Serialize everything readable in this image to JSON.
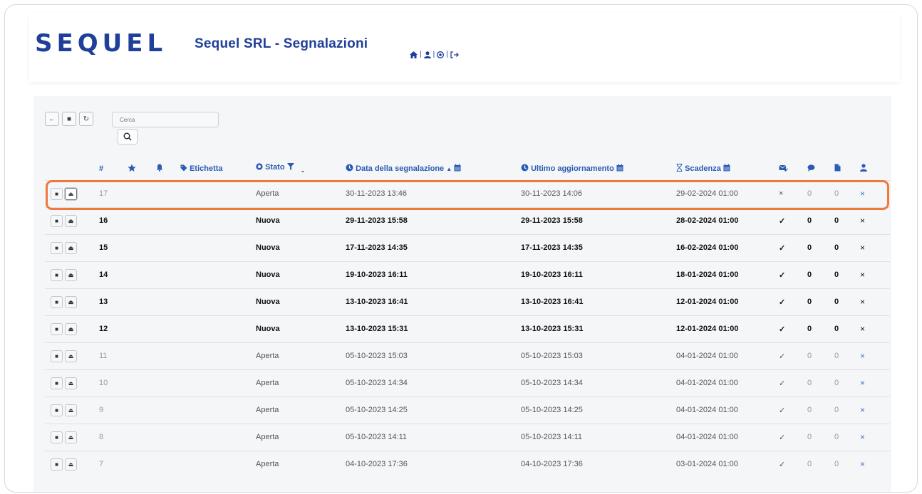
{
  "header": {
    "logo_text": "SEQUEL",
    "title": "Sequel SRL - Segnalazioni",
    "nav_icons": [
      "home-icon",
      "user-icon",
      "settings-icon",
      "logout-icon"
    ]
  },
  "toolbar": {
    "back_icon": "←",
    "stop_icon": "■",
    "refresh_icon": "↻"
  },
  "search": {
    "placeholder": "Cerca"
  },
  "table": {
    "columns": {
      "hash": "#",
      "label": "Etichetta",
      "status": "Stato",
      "date": "Data della segnalazione",
      "updated": "Ultimo aggiornamento",
      "deadline": "Scadenza"
    },
    "rows": [
      {
        "id": "17",
        "stato": "Aperta",
        "data": "30-11-2023 13:46",
        "ultimo": "30-11-2023 14:06",
        "scadenza": "29-02-2024 01:00",
        "mail": "×",
        "commenti": "0",
        "allegati": "0",
        "user": "×"
      },
      {
        "id": "16",
        "stato": "Nuova",
        "data": "29-11-2023 15:58",
        "ultimo": "29-11-2023 15:58",
        "scadenza": "28-02-2024 01:00",
        "mail": "✓",
        "commenti": "0",
        "allegati": "0",
        "user": "×"
      },
      {
        "id": "15",
        "stato": "Nuova",
        "data": "17-11-2023 14:35",
        "ultimo": "17-11-2023 14:35",
        "scadenza": "16-02-2024 01:00",
        "mail": "✓",
        "commenti": "0",
        "allegati": "0",
        "user": "×"
      },
      {
        "id": "14",
        "stato": "Nuova",
        "data": "19-10-2023 16:11",
        "ultimo": "19-10-2023 16:11",
        "scadenza": "18-01-2024 01:00",
        "mail": "✓",
        "commenti": "0",
        "allegati": "0",
        "user": "×"
      },
      {
        "id": "13",
        "stato": "Nuova",
        "data": "13-10-2023 16:41",
        "ultimo": "13-10-2023 16:41",
        "scadenza": "12-01-2024 01:00",
        "mail": "✓",
        "commenti": "0",
        "allegati": "0",
        "user": "×"
      },
      {
        "id": "12",
        "stato": "Nuova",
        "data": "13-10-2023 15:31",
        "ultimo": "13-10-2023 15:31",
        "scadenza": "12-01-2024 01:00",
        "mail": "✓",
        "commenti": "0",
        "allegati": "0",
        "user": "×"
      },
      {
        "id": "11",
        "stato": "Aperta",
        "data": "05-10-2023 15:03",
        "ultimo": "05-10-2023 15:03",
        "scadenza": "04-01-2024 01:00",
        "mail": "✓",
        "commenti": "0",
        "allegati": "0",
        "user": "×"
      },
      {
        "id": "10",
        "stato": "Aperta",
        "data": "05-10-2023 14:34",
        "ultimo": "05-10-2023 14:34",
        "scadenza": "04-01-2024 01:00",
        "mail": "✓",
        "commenti": "0",
        "allegati": "0",
        "user": "×"
      },
      {
        "id": "9",
        "stato": "Aperta",
        "data": "05-10-2023 14:25",
        "ultimo": "05-10-2023 14:25",
        "scadenza": "04-01-2024 01:00",
        "mail": "✓",
        "commenti": "0",
        "allegati": "0",
        "user": "×"
      },
      {
        "id": "8",
        "stato": "Aperta",
        "data": "05-10-2023 14:11",
        "ultimo": "05-10-2023 14:11",
        "scadenza": "04-01-2024 01:00",
        "mail": "✓",
        "commenti": "0",
        "allegati": "0",
        "user": "×"
      },
      {
        "id": "7",
        "stato": "Aperta",
        "data": "04-10-2023 17:36",
        "ultimo": "04-10-2023 17:36",
        "scadenza": "03-01-2024 01:00",
        "mail": "✓",
        "commenti": "0",
        "allegati": "0",
        "user": "×"
      }
    ]
  },
  "colors": {
    "brand": "#1f3f99",
    "link": "#2b5bb3",
    "highlight": "#f0783c"
  }
}
